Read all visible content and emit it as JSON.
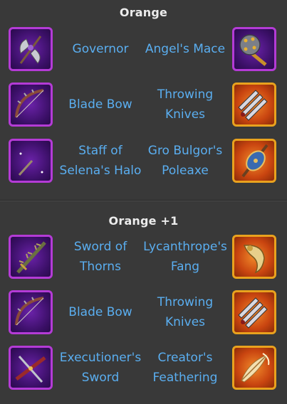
{
  "sections": [
    {
      "title": "Orange",
      "rows": [
        {
          "left": {
            "name": "Governor",
            "icon": "battle-axe-icon"
          },
          "right": {
            "name": "Angel's Mace",
            "icon": "spiked-mace-icon"
          }
        },
        {
          "left": {
            "name": "Blade Bow",
            "icon": "bow-icon"
          },
          "right": {
            "name": "Throwing Knives",
            "icon": "throwing-knives-icon"
          }
        },
        {
          "left": {
            "name": "Staff of Selena's Halo",
            "icon": "crescent-staff-icon"
          },
          "right": {
            "name": "Gro Bulgor's Poleaxe",
            "icon": "poleaxe-icon"
          }
        }
      ]
    },
    {
      "title": "Orange +1",
      "rows": [
        {
          "left": {
            "name": "Sword of Thorns",
            "icon": "thorn-sword-icon"
          },
          "right": {
            "name": "Lycanthrope's Fang",
            "icon": "fang-icon"
          }
        },
        {
          "left": {
            "name": "Blade Bow",
            "icon": "bow-icon"
          },
          "right": {
            "name": "Throwing Knives",
            "icon": "throwing-knives-icon"
          }
        },
        {
          "left": {
            "name": "Executioner's Sword",
            "icon": "crossbow-icon"
          },
          "right": {
            "name": "Creator's Feathering",
            "icon": "winged-feather-icon"
          }
        }
      ]
    }
  ],
  "colors": {
    "background": "#393939",
    "item_text": "#5aaef0",
    "title_text": "#ececec",
    "purple_frame": "#b43bd6",
    "gold_frame": "#e9a21e"
  }
}
